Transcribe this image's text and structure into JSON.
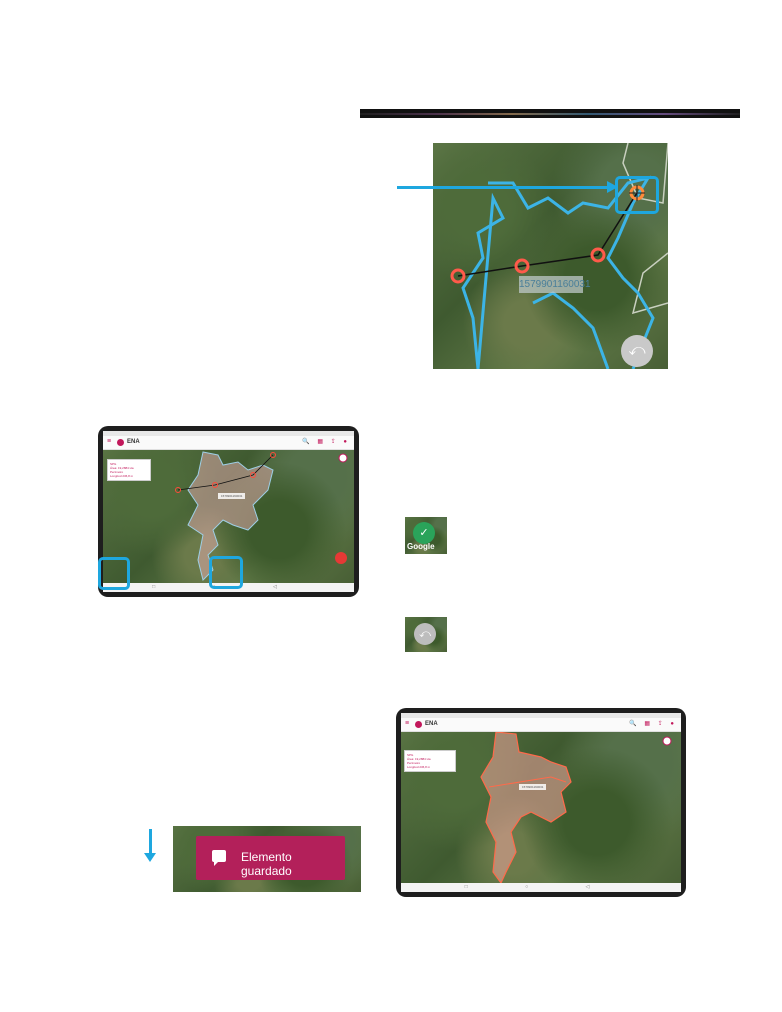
{
  "zoom_view": {
    "parcel_id": "1579901160031",
    "undo_glyph": "⤺",
    "highlight_color": "#1ea7df",
    "vertex_color": "#ff5a4a",
    "boundary_color": "#3cb4e6"
  },
  "tablet_app": {
    "app_name": "ENA",
    "menu_glyph": "≡",
    "toolbar_icons": "🔍 ▦ ⇪ ●",
    "nav_glyphs": "□ ○ ◁",
    "info_lines": [
      "SPG",
      "Área: 19,2884 Ha",
      "Perímetro",
      "Longitud 236,8 m"
    ],
    "map_chip": "1579901160031",
    "brand": "Google"
  },
  "confirm_button": {
    "glyph": "✓",
    "icon": "check-icon",
    "color": "#2aa35a",
    "watermark": "Google"
  },
  "undo_button": {
    "glyph": "⤺",
    "icon": "undo-icon",
    "color": "#bdbdbd"
  },
  "snackbar": {
    "message": "Elemento guardado",
    "icon": "message-icon",
    "color": "#b3205a"
  }
}
